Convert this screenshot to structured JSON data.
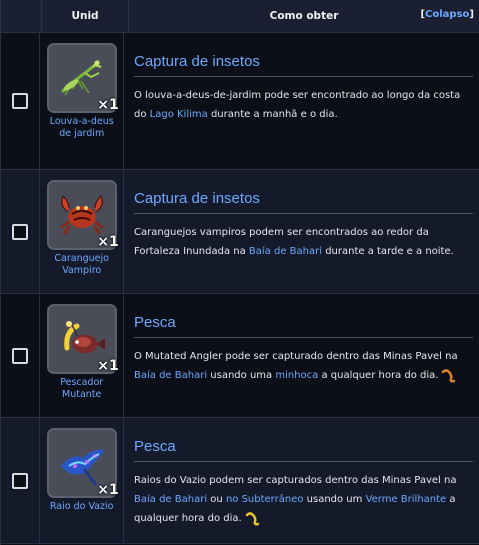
{
  "header": {
    "col_unid": "Unid",
    "col_como": "Como obter",
    "collapse_open": "[",
    "collapse_link": "Colapso",
    "collapse_close": "]"
  },
  "rows": [
    {
      "item_name": "Louva-a-deus de jardim",
      "qty": "1",
      "icon": "praying-mantis-icon",
      "method": "Captura de insetos",
      "desc": [
        {
          "t": "O louva-a-deus-de-jardim pode ser encontrado ao longo da costa do "
        },
        {
          "t": "Lago Kilima",
          "link": true
        },
        {
          "t": " durante a manhã e o dia."
        }
      ]
    },
    {
      "item_name": "Caranguejo Vampiro",
      "qty": "1",
      "icon": "vampire-crab-icon",
      "method": "Captura de insetos",
      "desc": [
        {
          "t": "Caranguejos vampiros podem ser encontrados ao redor da Fortaleza Inundada na "
        },
        {
          "t": "Baía de Bahari",
          "link": true
        },
        {
          "t": " durante a tarde e a noite."
        }
      ]
    },
    {
      "item_name": "Pescador Mutante",
      "qty": "1",
      "icon": "mutated-angler-icon",
      "method": "Pesca",
      "desc": [
        {
          "t": "O Mutated Angler pode ser capturado dentro das Minas Pavel na "
        },
        {
          "t": "Baía de Bahari",
          "link": true
        },
        {
          "t": " usando uma "
        },
        {
          "t": "minhoca",
          "link": true
        },
        {
          "t": " a qualquer hora do dia."
        }
      ],
      "bait_icon": "worm-icon",
      "bait_color": "#d9822b"
    },
    {
      "item_name": "Raio do Vazio",
      "qty": "1",
      "icon": "void-ray-icon",
      "method": "Pesca",
      "desc": [
        {
          "t": "Raios do Vazio podem ser capturados dentro das Minas Pavel na "
        },
        {
          "t": "Baía de Bahari",
          "link": true
        },
        {
          "t": " ou "
        },
        {
          "t": "no Subterrâneo",
          "link": true
        },
        {
          "t": " usando um "
        },
        {
          "t": "Verme Brilhante",
          "link": true
        },
        {
          "t": " a qualquer hora do dia."
        }
      ],
      "bait_icon": "glow-worm-icon",
      "bait_color": "#e8c22a"
    }
  ],
  "colors": {
    "link": "#6ea8ff",
    "header_bg": "#1a2032",
    "row_dark": "#0c0f17",
    "row_light": "#141a2a"
  }
}
